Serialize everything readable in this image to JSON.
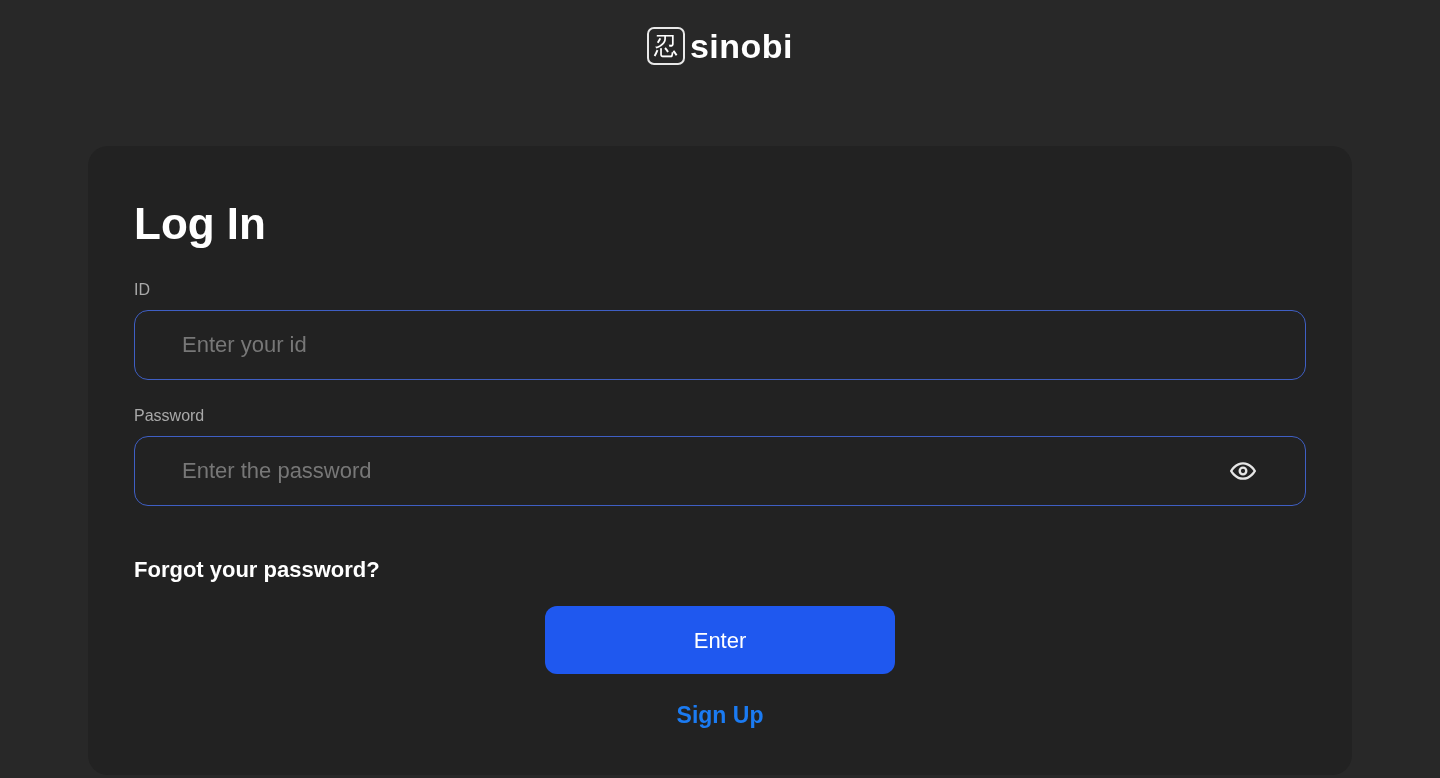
{
  "logo": {
    "mark": "忍",
    "wordmark": "sinobi"
  },
  "form": {
    "title": "Log In",
    "fields": [
      {
        "kind": "text",
        "label": "ID",
        "placeholder": "Enter your id"
      },
      {
        "kind": "password",
        "label": "Password",
        "placeholder": "Enter the password"
      }
    ],
    "forgot_link": "Forgot your password?",
    "submit_button": "Enter",
    "signup_link": "Sign Up"
  }
}
